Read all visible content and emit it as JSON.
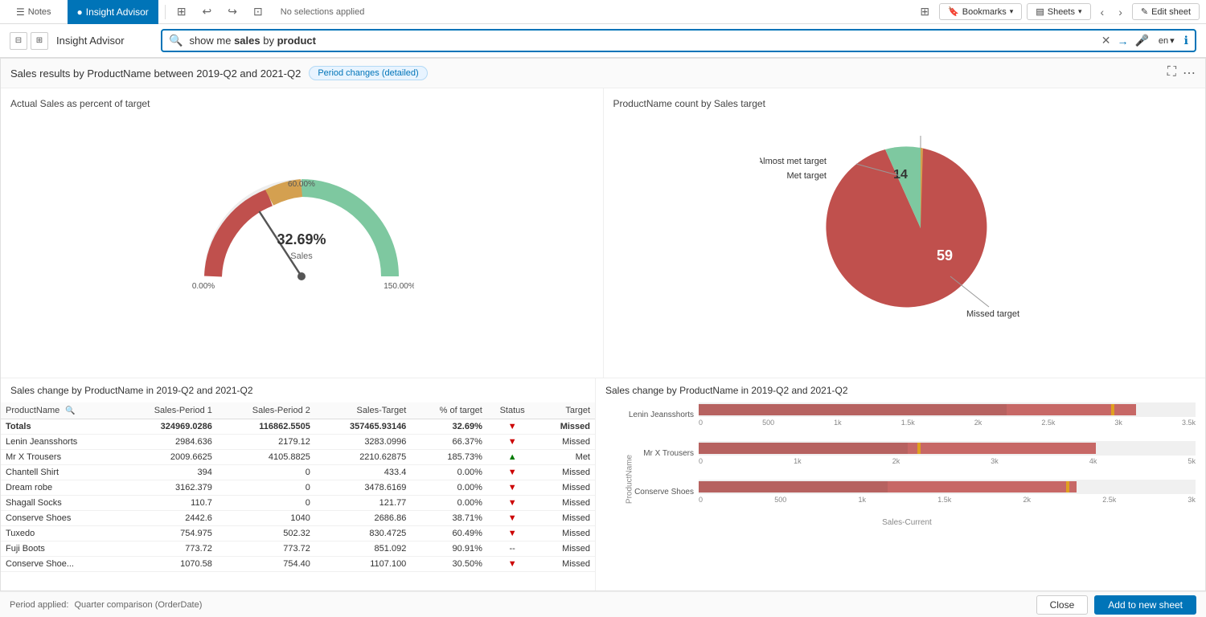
{
  "topnav": {
    "notes_label": "Notes",
    "insight_label": "Insight Advisor",
    "no_selections": "No selections applied",
    "bookmarks_label": "Bookmarks",
    "sheets_label": "Sheets",
    "edit_sheet_label": "Edit sheet"
  },
  "secondbar": {
    "title": "Insight Advisor"
  },
  "search": {
    "prefix": "show me ",
    "highlight1": "sales",
    "middle": " by ",
    "highlight2": "product",
    "lang": "en"
  },
  "insight": {
    "header_title": "Sales results by ProductName between 2019-Q2 and 2021-Q2",
    "period_badge": "Period changes (detailed)",
    "advisor_title": "Insight Advisor",
    "gauge_title": "Actual Sales as percent of target",
    "gauge_value": "32.69%",
    "gauge_sublabel": "Sales",
    "gauge_label_top": "60.00%",
    "gauge_label_left": "0.00%",
    "gauge_label_right": "150.00%",
    "pie_title": "ProductName count by Sales target",
    "pie_met": "Met target",
    "pie_almost": "Almost met target",
    "pie_missed": "Missed target",
    "pie_met_value": 14,
    "pie_missed_value": 59,
    "table_title": "Sales change by ProductName in 2019-Q2 and 2021-Q2",
    "barchart_title": "Sales change by ProductName in 2019-Q2 and 2021-Q2",
    "x_axis_label": "Sales-Current",
    "y_axis_label": "ProductName"
  },
  "table": {
    "col_product": "ProductName",
    "col_period1": "Sales-Period 1",
    "col_period2": "Sales-Period 2",
    "col_target": "Sales-Target",
    "col_pct": "% of target",
    "col_status": "Status",
    "col_target2": "Target",
    "rows": [
      {
        "product": "Totals",
        "period1": "324969.0286",
        "period2": "116862.5505",
        "target": "357465.93146",
        "pct": "32.69%",
        "arrow": "▼",
        "status": "Missed",
        "bold": true
      },
      {
        "product": "Lenin Jeansshorts",
        "period1": "2984.636",
        "period2": "2179.12",
        "target": "3283.0996",
        "pct": "66.37%",
        "arrow": "▼",
        "status": "Missed",
        "bold": false
      },
      {
        "product": "Mr X Trousers",
        "period1": "2009.6625",
        "period2": "4105.8825",
        "target": "2210.62875",
        "pct": "185.73%",
        "arrow": "▲",
        "status": "Met",
        "bold": false
      },
      {
        "product": "Chantell Shirt",
        "period1": "394",
        "period2": "0",
        "target": "433.4",
        "pct": "0.00%",
        "arrow": "▼",
        "status": "Missed",
        "bold": false
      },
      {
        "product": "Dream robe",
        "period1": "3162.379",
        "period2": "0",
        "target": "3478.6169",
        "pct": "0.00%",
        "arrow": "▼",
        "status": "Missed",
        "bold": false
      },
      {
        "product": "Shagall Socks",
        "period1": "110.7",
        "period2": "0",
        "target": "121.77",
        "pct": "0.00%",
        "arrow": "▼",
        "status": "Missed",
        "bold": false
      },
      {
        "product": "Conserve Shoes",
        "period1": "2442.6",
        "period2": "1040",
        "target": "2686.86",
        "pct": "38.71%",
        "arrow": "▼",
        "status": "Missed",
        "bold": false
      },
      {
        "product": "Tuxedo",
        "period1": "754.975",
        "period2": "502.32",
        "target": "830.4725",
        "pct": "60.49%",
        "arrow": "▼",
        "status": "Missed",
        "bold": false
      },
      {
        "product": "Fuji Boots",
        "period1": "773.72",
        "period2": "773.72",
        "target": "851.092",
        "pct": "90.91%",
        "arrow": "--",
        "status": "Missed",
        "bold": false
      },
      {
        "product": "Conserve Shoe...",
        "period1": "1070.58",
        "period2": "754.40",
        "target": "1107.100",
        "pct": "30.50%",
        "arrow": "▼",
        "status": "Missed",
        "bold": false
      }
    ]
  },
  "barchart": {
    "bars": [
      {
        "label": "Lenin Jeansshorts",
        "teal_pct": 62,
        "red_pct": 88,
        "marker_pct": 85,
        "axis_labels": [
          "0",
          "500",
          "1k",
          "1.5k",
          "2k",
          "2.5k",
          "3k",
          "3.5k"
        ]
      },
      {
        "label": "Mr X Trousers",
        "teal_pct": 42,
        "red_pct": 80,
        "marker_pct": 44,
        "axis_labels": [
          "0",
          "1k",
          "2k",
          "3k",
          "4k",
          "5k"
        ]
      },
      {
        "label": "Conserve Shoes",
        "teal_pct": 38,
        "red_pct": 78,
        "marker_pct": 74,
        "axis_labels": [
          "0",
          "500",
          "1k",
          "1.5k",
          "2k",
          "2.5k",
          "3k"
        ]
      }
    ]
  },
  "footer": {
    "period_label": "Period applied:",
    "period_value": "Quarter comparison (OrderDate)",
    "close_label": "Close",
    "add_label": "Add to new sheet"
  }
}
